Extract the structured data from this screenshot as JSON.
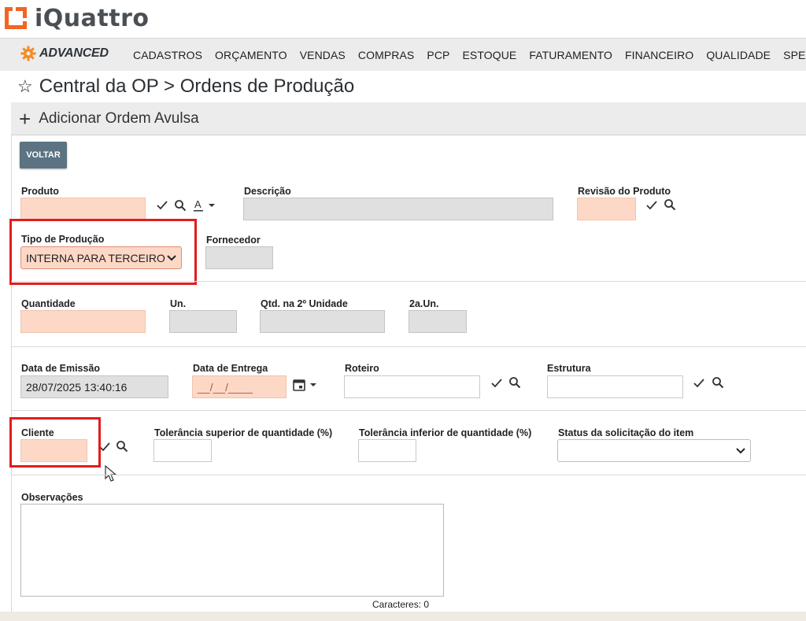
{
  "app": {
    "logo_text": "iQuattro"
  },
  "navbar": {
    "brand": "ADVANCED",
    "items": [
      "CADASTROS",
      "ORÇAMENTO",
      "VENDAS",
      "COMPRAS",
      "PCP",
      "ESTOQUE",
      "FATURAMENTO",
      "FINANCEIRO",
      "QUALIDADE",
      "SPED"
    ]
  },
  "page": {
    "title": "Central da OP > Ordens de Produção"
  },
  "add_bar": {
    "label": "Adicionar Ordem Avulsa"
  },
  "form": {
    "voltar": "VOLTAR",
    "produto": {
      "label": "Produto",
      "value": ""
    },
    "descricao": {
      "label": "Descrição",
      "value": ""
    },
    "revisao": {
      "label": "Revisão do Produto",
      "value": ""
    },
    "tipo_producao": {
      "label": "Tipo de Produção",
      "selected": "INTERNA PARA TERCEIRO"
    },
    "fornecedor": {
      "label": "Fornecedor",
      "value": ""
    },
    "quantidade": {
      "label": "Quantidade",
      "value": ""
    },
    "un": {
      "label": "Un.",
      "value": ""
    },
    "qtd_2": {
      "label": "Qtd. na 2º Unidade",
      "value": ""
    },
    "un_2": {
      "label": "2a.Un.",
      "value": ""
    },
    "data_emissao": {
      "label": "Data de Emissão",
      "value": "28/07/2025 13:40:16"
    },
    "data_entrega": {
      "label": "Data de Entrega",
      "placeholder": "__/__/____"
    },
    "roteiro": {
      "label": "Roteiro",
      "value": ""
    },
    "estrutura": {
      "label": "Estrutura",
      "value": ""
    },
    "cliente": {
      "label": "Cliente",
      "value": ""
    },
    "tol_sup": {
      "label": "Tolerância superior de quantidade (%)",
      "value": ""
    },
    "tol_inf": {
      "label": "Tolerância inferior de quantidade (%)",
      "value": ""
    },
    "status_item": {
      "label": "Status da solicitação do item",
      "selected": ""
    },
    "observacoes": {
      "label": "Observações",
      "value": ""
    },
    "caracteres": "Caracteres: 0"
  },
  "colors": {
    "required_bg": "#fdd8c6",
    "readonly_bg": "#e0e0e0",
    "button_bg": "#5b7382",
    "highlight": "#e11d1d",
    "logo_orange": "#f26522"
  }
}
